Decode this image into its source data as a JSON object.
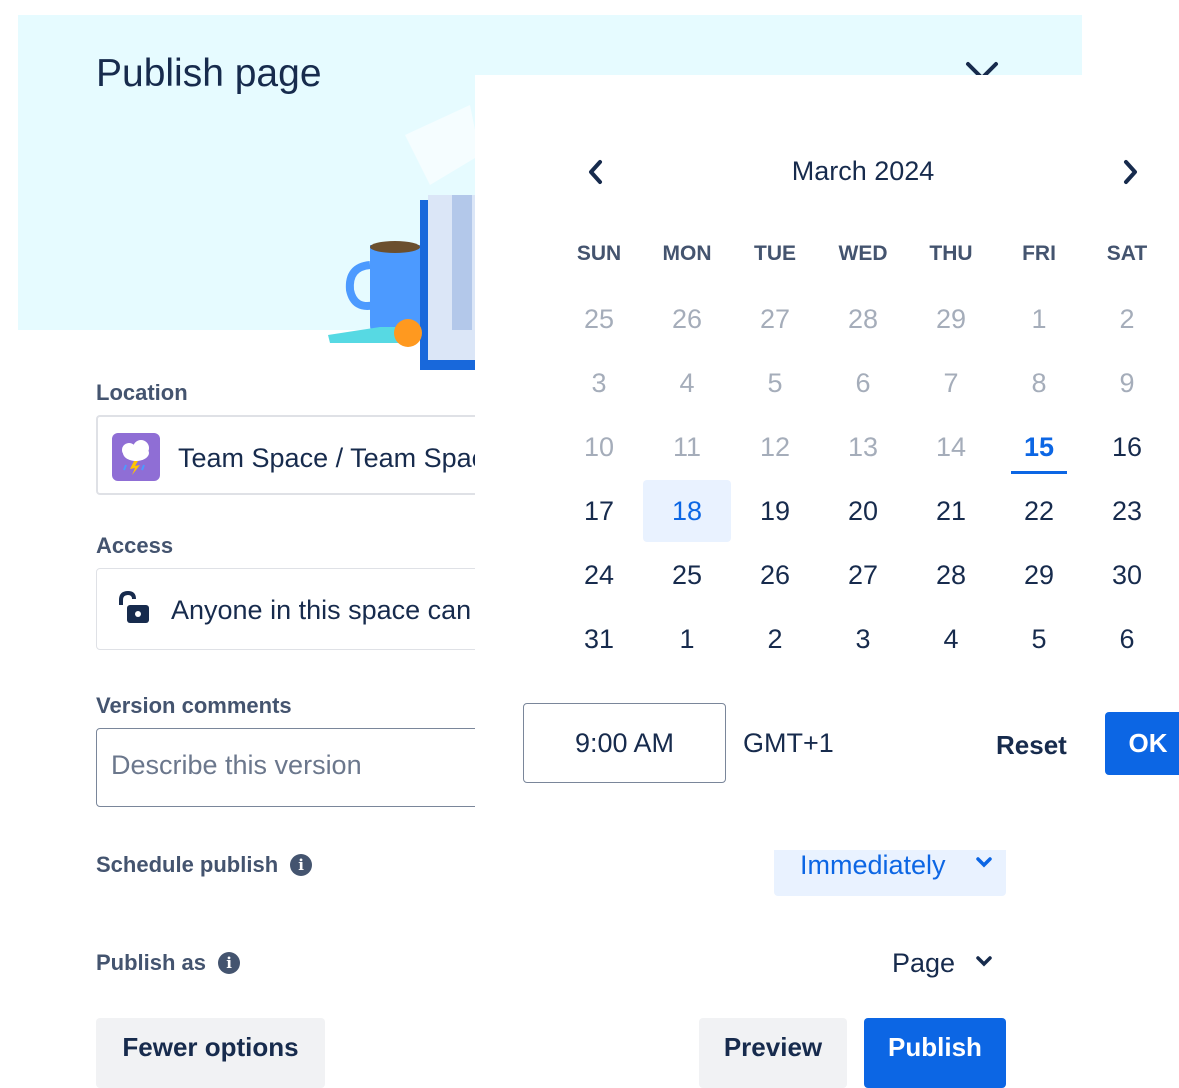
{
  "dialog": {
    "title": "Publish page"
  },
  "location": {
    "label": "Location",
    "value": "Team Space / Team Space"
  },
  "access": {
    "label": "Access",
    "value": "Anyone in this space can"
  },
  "version": {
    "label": "Version comments",
    "placeholder": "Describe this version"
  },
  "schedule": {
    "label": "Schedule publish",
    "value": "Immediately"
  },
  "publish_as": {
    "label": "Publish as",
    "value": "Page"
  },
  "buttons": {
    "fewer": "Fewer options",
    "preview": "Preview",
    "publish": "Publish"
  },
  "calendar": {
    "month": "March 2024",
    "weekdays": [
      "SUN",
      "MON",
      "TUE",
      "WED",
      "THU",
      "FRI",
      "SAT"
    ],
    "days": [
      [
        "25",
        "26",
        "27",
        "28",
        "29",
        "1",
        "2"
      ],
      [
        "3",
        "4",
        "5",
        "6",
        "7",
        "8",
        "9"
      ],
      [
        "10",
        "11",
        "12",
        "13",
        "14",
        "15",
        "16"
      ],
      [
        "17",
        "18",
        "19",
        "20",
        "21",
        "22",
        "23"
      ],
      [
        "24",
        "25",
        "26",
        "27",
        "28",
        "29",
        "30"
      ],
      [
        "31",
        "1",
        "2",
        "3",
        "4",
        "5",
        "6"
      ]
    ],
    "today": "15",
    "selected": "18",
    "time": "9:00 AM",
    "timezone": "GMT+1",
    "reset": "Reset",
    "ok": "OK"
  },
  "colors": {
    "hero": "#e6fbff",
    "accent": "#0c66e4",
    "selected_bg": "#e9f2ff"
  }
}
